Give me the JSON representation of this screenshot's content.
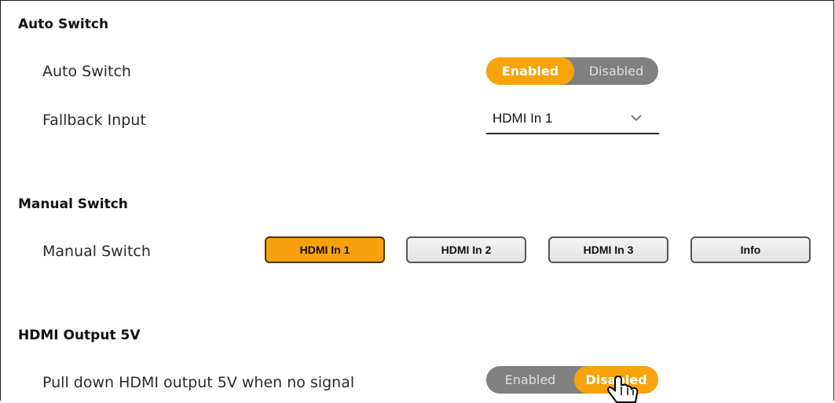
{
  "auto_switch": {
    "section_title": "Auto Switch",
    "auto_switch_label": "Auto Switch",
    "toggle": {
      "enabled_label": "Enabled",
      "disabled_label": "Disabled",
      "selected": "Enabled"
    },
    "fallback_label": "Fallback Input",
    "fallback_value": "HDMI In 1"
  },
  "manual_switch": {
    "section_title": "Manual Switch",
    "row_label": "Manual Switch",
    "buttons": [
      {
        "label": "HDMI In 1",
        "active": true
      },
      {
        "label": "HDMI In 2",
        "active": false
      },
      {
        "label": "HDMI In 3",
        "active": false
      },
      {
        "label": "Info",
        "active": false
      }
    ]
  },
  "hdmi_output_5v": {
    "section_title": "HDMI Output 5V",
    "row_label": "Pull down HDMI output 5V when no signal",
    "toggle": {
      "enabled_label": "Enabled",
      "disabled_label": "Disabled",
      "selected": "Disabled"
    }
  },
  "colors": {
    "accent": "#f7a30a",
    "toggle_off": "#808080"
  },
  "icons": {
    "dropdown": "chevron-down-icon",
    "pointer": "hand-pointer-icon"
  }
}
